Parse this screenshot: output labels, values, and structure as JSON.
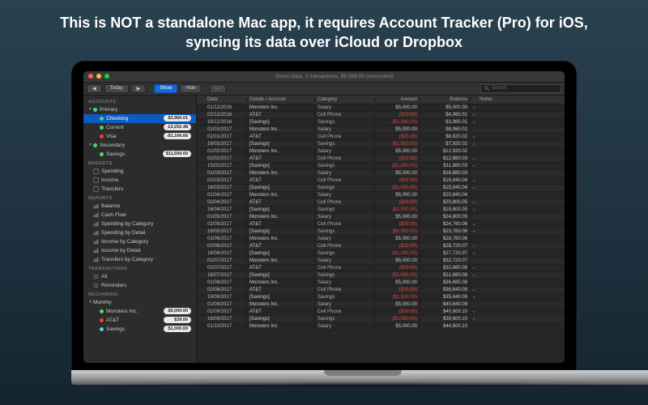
{
  "promo": "This is NOT a standalone Mac app, it requires Account Tracker (Pro) for iOS, syncing its data over iCloud or Dropbox",
  "window": {
    "title": "Demo Data, 3 transactions, $5,589.05 (reconciled)"
  },
  "toolbar": {
    "today": "Today",
    "show": "Show",
    "hide": "Hide",
    "search_placeholder": "Search"
  },
  "sidebar": {
    "accounts": {
      "label": "ACCOUNTS",
      "groups": [
        {
          "name": "Primary",
          "items": [
            {
              "name": "Checking",
              "balance": "$3,960.01",
              "dot": "g",
              "selected": true
            },
            {
              "name": "Current",
              "balance": "£2,252.48",
              "dot": "g"
            },
            {
              "name": "Visa",
              "balance": "-$1,166.66",
              "dot": "r"
            }
          ]
        },
        {
          "name": "Secondary",
          "items": [
            {
              "name": "Savings",
              "balance": "$11,500.00",
              "dot": "g"
            }
          ]
        }
      ]
    },
    "budgets": {
      "label": "BUDGETS",
      "items": [
        "Spending",
        "Income",
        "Transfers"
      ]
    },
    "reports": {
      "label": "REPORTS",
      "items": [
        "Balance",
        "Cash Flow",
        "Spending by Category",
        "Spending by Detail",
        "Income by Category",
        "Income by Detail",
        "Transfers by Category"
      ]
    },
    "transactions": {
      "label": "TRANSACTIONS",
      "items": [
        "All",
        "Reminders"
      ]
    },
    "recurring": {
      "label": "RECURRING",
      "group": "Monthly",
      "items": [
        {
          "name": "Monsters Inc.",
          "amount": "$5,000.00",
          "dot": "g"
        },
        {
          "name": "AT&T",
          "amount": "$39.00",
          "dot": "r"
        },
        {
          "name": "Savings",
          "amount": "$1,000.00",
          "dot": "b"
        }
      ]
    }
  },
  "columns": {
    "date": "Date",
    "details": "Details / Account",
    "category": "Category",
    "amount": "Amount",
    "balance": "Balance",
    "notes": "Notes"
  },
  "rows": [
    {
      "date": "01/12/2016",
      "det": "Monsters Inc.",
      "cat": "Salary",
      "amt": "$5,000.00",
      "bal": "$5,000.00",
      "neg": false,
      "rc": true
    },
    {
      "date": "02/12/2016",
      "det": "AT&T",
      "cat": "Cell Phone",
      "amt": "($39.99)",
      "bal": "$4,960.01",
      "neg": true,
      "rc": true
    },
    {
      "date": "16/12/2016",
      "det": "[Savings]",
      "cat": "Savings",
      "amt": "($1,000.00)",
      "bal": "$3,960.01",
      "neg": true,
      "rc": true
    },
    {
      "date": "01/01/2017",
      "det": "Monsters Inc.",
      "cat": "Salary",
      "amt": "$5,000.00",
      "bal": "$8,960.01",
      "neg": false,
      "rc": false
    },
    {
      "date": "02/01/2017",
      "det": "AT&T",
      "cat": "Cell Phone",
      "amt": "($39.99)",
      "bal": "$8,920.02",
      "neg": true,
      "rc": true
    },
    {
      "date": "16/01/2017",
      "det": "[Savings]",
      "cat": "Savings",
      "amt": "($1,000.00)",
      "bal": "$7,920.02",
      "neg": true,
      "rc": true
    },
    {
      "date": "01/02/2017",
      "det": "Monsters Inc.",
      "cat": "Salary",
      "amt": "$5,000.00",
      "bal": "$12,920.02",
      "neg": false,
      "rc": false
    },
    {
      "date": "02/02/2017",
      "det": "AT&T",
      "cat": "Cell Phone",
      "amt": "($39.99)",
      "bal": "$12,880.03",
      "neg": true,
      "rc": true
    },
    {
      "date": "15/02/2017",
      "det": "[Savings]",
      "cat": "Savings",
      "amt": "($1,000.00)",
      "bal": "$11,880.03",
      "neg": true,
      "rc": true
    },
    {
      "date": "01/03/2017",
      "det": "Monsters Inc.",
      "cat": "Salary",
      "amt": "$5,000.00",
      "bal": "$16,880.03",
      "neg": false,
      "rc": false
    },
    {
      "date": "02/03/2017",
      "det": "AT&T",
      "cat": "Cell Phone",
      "amt": "($39.99)",
      "bal": "$16,840.04",
      "neg": true,
      "rc": true
    },
    {
      "date": "16/03/2017",
      "det": "[Savings]",
      "cat": "Savings",
      "amt": "($1,000.00)",
      "bal": "$15,840.04",
      "neg": true,
      "rc": true
    },
    {
      "date": "01/04/2017",
      "det": "Monsters Inc.",
      "cat": "Salary",
      "amt": "$5,000.00",
      "bal": "$20,840.04",
      "neg": false,
      "rc": false
    },
    {
      "date": "02/04/2017",
      "det": "AT&T",
      "cat": "Cell Phone",
      "amt": "($39.99)",
      "bal": "$20,800.05",
      "neg": true,
      "rc": true
    },
    {
      "date": "16/04/2017",
      "det": "[Savings]",
      "cat": "Savings",
      "amt": "($1,000.00)",
      "bal": "$19,800.05",
      "neg": true,
      "rc": true
    },
    {
      "date": "01/05/2017",
      "det": "Monsters Inc.",
      "cat": "Salary",
      "amt": "$5,000.00",
      "bal": "$24,800.05",
      "neg": false,
      "rc": false
    },
    {
      "date": "02/05/2017",
      "det": "AT&T",
      "cat": "Cell Phone",
      "amt": "($39.99)",
      "bal": "$24,760.06",
      "neg": true,
      "rc": true
    },
    {
      "date": "16/05/2017",
      "det": "[Savings]",
      "cat": "Savings",
      "amt": "($1,000.00)",
      "bal": "$23,760.06",
      "neg": true,
      "rc": true
    },
    {
      "date": "01/06/2017",
      "det": "Monsters Inc.",
      "cat": "Salary",
      "amt": "$5,000.00",
      "bal": "$28,760.06",
      "neg": false,
      "rc": false
    },
    {
      "date": "02/06/2017",
      "det": "AT&T",
      "cat": "Cell Phone",
      "amt": "($39.99)",
      "bal": "$28,720.07",
      "neg": true,
      "rc": true
    },
    {
      "date": "16/06/2017",
      "det": "[Savings]",
      "cat": "Savings",
      "amt": "($1,000.00)",
      "bal": "$27,720.07",
      "neg": true,
      "rc": true
    },
    {
      "date": "01/07/2017",
      "det": "Monsters Inc.",
      "cat": "Salary",
      "amt": "$5,000.00",
      "bal": "$32,720.07",
      "neg": false,
      "rc": false
    },
    {
      "date": "02/07/2017",
      "det": "AT&T",
      "cat": "Cell Phone",
      "amt": "($39.99)",
      "bal": "$32,680.08",
      "neg": true,
      "rc": true
    },
    {
      "date": "16/07/2017",
      "det": "[Savings]",
      "cat": "Savings",
      "amt": "($1,000.00)",
      "bal": "$31,680.08",
      "neg": true,
      "rc": true
    },
    {
      "date": "01/08/2017",
      "det": "Monsters Inc.",
      "cat": "Salary",
      "amt": "$5,000.00",
      "bal": "$36,680.08",
      "neg": false,
      "rc": false
    },
    {
      "date": "02/08/2017",
      "det": "AT&T",
      "cat": "Cell Phone",
      "amt": "($39.99)",
      "bal": "$36,640.09",
      "neg": true,
      "rc": true
    },
    {
      "date": "16/08/2017",
      "det": "[Savings]",
      "cat": "Savings",
      "amt": "($1,000.00)",
      "bal": "$35,640.09",
      "neg": true,
      "rc": true
    },
    {
      "date": "01/09/2017",
      "det": "Monsters Inc.",
      "cat": "Salary",
      "amt": "$5,000.00",
      "bal": "$40,640.09",
      "neg": false,
      "rc": false
    },
    {
      "date": "02/09/2017",
      "det": "AT&T",
      "cat": "Cell Phone",
      "amt": "($39.99)",
      "bal": "$40,600.10",
      "neg": true,
      "rc": true
    },
    {
      "date": "16/09/2017",
      "det": "[Savings]",
      "cat": "Savings",
      "amt": "($1,000.00)",
      "bal": "$39,600.10",
      "neg": true,
      "rc": true
    },
    {
      "date": "01/10/2017",
      "det": "Monsters Inc.",
      "cat": "Salary",
      "amt": "$5,000.00",
      "bal": "$44,600.10",
      "neg": false,
      "rc": false
    }
  ]
}
